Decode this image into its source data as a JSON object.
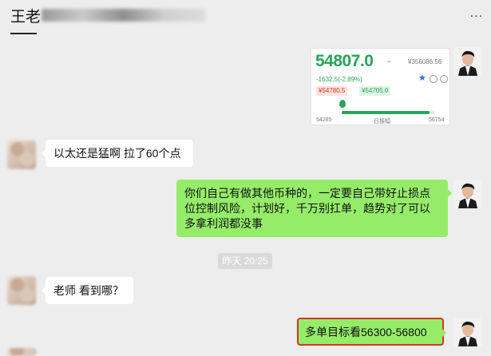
{
  "header": {
    "title": "王老",
    "more_icon": "more-icon",
    "more_glyph": "..."
  },
  "screenshot_card": {
    "price": "54807.0",
    "price_chevron": "⌄",
    "price_cny": "¥356086.56",
    "change": "-1632.5(-2.89%)",
    "low_tag": "¥54780.5",
    "high_tag": "¥54705.0",
    "range_low": "54285",
    "range_label": "日振幅",
    "range_high": "56754",
    "range_fill_fraction": 0.95,
    "colors": {
      "up": "#27a55a",
      "down": "#d6361c",
      "accent": "#2b6bd6"
    }
  },
  "messages": [
    {
      "side": "left",
      "text": "以太还是猛啊 拉了60个点"
    },
    {
      "side": "right",
      "text": "你们自己有做其他币种的，一定要自己带好止损点位控制风险，计划好，千万别扛单，趋势对了可以多拿利润都没事"
    },
    {
      "side": "left",
      "text": "老师 看到哪？"
    },
    {
      "side": "right",
      "text": "多单目标看56300-56800",
      "highlighted": true
    }
  ],
  "timestamp": "昨天 20:25",
  "colors": {
    "background": "#ededed",
    "green_bubble": "#95ec69",
    "white_bubble": "#ffffff",
    "highlight_border": "#d6361c"
  }
}
